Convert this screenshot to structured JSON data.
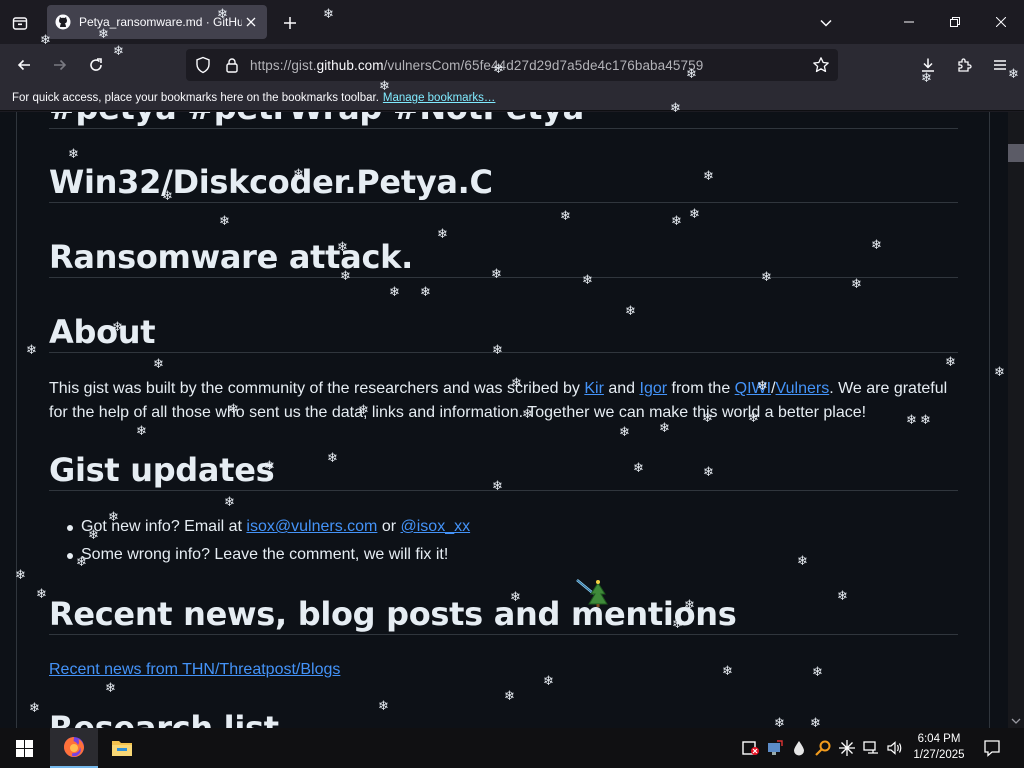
{
  "browser": {
    "tab_title": "Petya_ransomware.md · GitHub",
    "url_prefix": "https://gist.",
    "url_domain": "github.com",
    "url_path": "/vulnersCom/65fe44d27d29d7a5de4c176baba45759",
    "bookmarks_message": "For quick access, place your bookmarks here on the bookmarks toolbar.",
    "bookmarks_link": "Manage bookmarks…"
  },
  "content": {
    "partial_heading": "#petya #petrWrap #NotPetya",
    "heading_1": "Win32/Diskcoder.Petya.C",
    "heading_2": "Ransomware attack.",
    "about_heading": "About",
    "about_text_1": "This gist was built by the community of the researchers and was scribed by ",
    "about_link_kir": "Kir",
    "about_text_and": " and ",
    "about_link_igor": "Igor",
    "about_text_from": " from the ",
    "about_link_qiwi": "QIWI",
    "about_text_slash": "/",
    "about_link_vulners": "Vulners",
    "about_text_2": ". We are grateful for the help of all those who sent us the data, links and information. Together we can make this world a better place!",
    "updates_heading": "Gist updates",
    "update_1_text": "Got new info? Email at ",
    "update_1_email": "isox@vulners.com",
    "update_1_or": " or ",
    "update_1_handle": "@isox_xx",
    "update_2_text": "Some wrong info? Leave the comment, we will fix it!",
    "news_heading": "Recent news, blog posts and mentions",
    "news_link": "Recent news from THN/Threatpost/Blogs",
    "partial_bottom_heading": "Research list"
  },
  "taskbar": {
    "time": "6:04 PM",
    "date": "1/27/2025",
    "apps": [
      "firefox-icon",
      "file-explorer-icon"
    ],
    "tray_icons": [
      "shield-x-icon",
      "network-share-icon",
      "water-drop-icon",
      "key-icon",
      "sparkle-icon",
      "network-icon",
      "volume-icon"
    ]
  },
  "colors": {
    "page_bg": "#0d1117",
    "text": "#e6edf3",
    "link": "#4493f8",
    "border": "#30363d",
    "chrome_bg": "#2b2a33",
    "tab_active": "#42414d"
  }
}
